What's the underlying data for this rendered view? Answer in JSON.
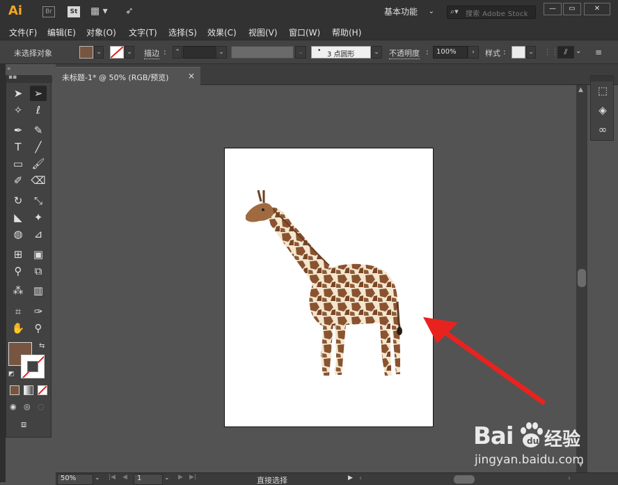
{
  "app": {
    "logo": "Ai",
    "bridge_chip": "Br",
    "stock_chip": "St",
    "workspace_label": "基本功能",
    "search_placeholder": "搜索 Adobe Stock",
    "window_minimize": "—",
    "window_restore": "▭",
    "window_close": "✕"
  },
  "menu": {
    "items": [
      "文件(F)",
      "编辑(E)",
      "对象(O)",
      "文字(T)",
      "选择(S)",
      "效果(C)",
      "视图(V)",
      "窗口(W)",
      "帮助(H)"
    ]
  },
  "control_bar": {
    "selection_status": "未选择对象",
    "stroke_label": "描边",
    "brush_label": "3 点圆形",
    "opacity_label": "不透明度",
    "opacity_value": "100%",
    "style_label": "样式"
  },
  "colors": {
    "fill": "#785540",
    "stroke": "none",
    "accent": "#f5a623",
    "arrow": "#e8231f"
  },
  "document": {
    "tab_title": "未标题-1* @ 50% (RGB/预览)",
    "tab_close": "×"
  },
  "status_bar": {
    "zoom": "50%",
    "artboard_number": "1",
    "current_tool": "直接选择"
  },
  "watermark": {
    "brand": "Bai",
    "brand_cn": "经验",
    "url": "jingyan.baidu.com"
  },
  "icons": {
    "left_tools": [
      "selection-tool-icon",
      "direct-selection-tool-icon",
      "magic-wand-tool-icon",
      "lasso-tool-icon",
      "pen-tool-icon",
      "curvature-tool-icon",
      "type-tool-icon",
      "line-segment-tool-icon",
      "rectangle-tool-icon",
      "paintbrush-tool-icon",
      "shaper-tool-icon",
      "eraser-tool-icon",
      "rotate-tool-icon",
      "scale-tool-icon",
      "width-tool-icon",
      "puppet-warp-tool-icon",
      "shape-builder-tool-icon",
      "perspective-grid-tool-icon",
      "mesh-tool-icon",
      "gradient-tool-icon",
      "eyedropper-tool-icon",
      "blend-tool-icon",
      "symbol-sprayer-tool-icon",
      "column-graph-tool-icon",
      "artboard-tool-icon",
      "slice-tool-icon",
      "hand-tool-icon",
      "zoom-tool-icon"
    ],
    "right_panels": [
      "libraries-icon",
      "layers-icon",
      "creative-cloud-icon"
    ]
  }
}
